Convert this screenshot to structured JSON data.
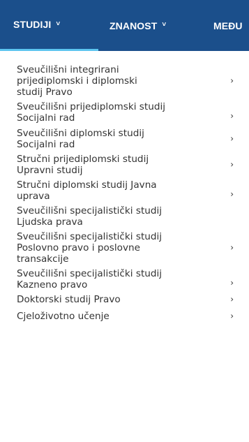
{
  "nav": {
    "items": [
      {
        "label": "STUDIJI",
        "active": true
      },
      {
        "label": "ZNANOST",
        "active": false
      },
      {
        "label": "MEĐU",
        "active": false
      }
    ],
    "chevron": "˅"
  },
  "menu": {
    "arrow": "›",
    "items": [
      {
        "label": "Sveučilišni integrirani\nprijediplomski i diplomski\nstudij Pravo",
        "has_arrow": true
      },
      {
        "label": "Sveučilišni prijediplomski studij\nSocijalni rad",
        "has_arrow": true
      },
      {
        "label": "Sveučilišni diplomski studij\nSocijalni rad",
        "has_arrow": true
      },
      {
        "label": "Stručni prijediplomski studij\nUpravni studij",
        "has_arrow": true
      },
      {
        "label": "Stručni diplomski studij Javna\nuprava",
        "has_arrow": true
      },
      {
        "label": "Sveučilišni specijalistički studij\nLjudska prava",
        "has_arrow": false
      },
      {
        "label": "Sveučilišni specijalistički studij\nPoslovno pravo i poslovne\ntransakcije",
        "has_arrow": true
      },
      {
        "label": "Sveučilišni specijalistički studij\nKazneno pravo",
        "has_arrow": true
      },
      {
        "label": "Doktorski studij Pravo",
        "has_arrow": true
      },
      {
        "label": "Cjeloživotno učenje",
        "has_arrow": true
      }
    ]
  },
  "colors": {
    "nav_bg": "#1b4f8b",
    "nav_text": "#ffffff",
    "active_underline": "#5dc5ef",
    "menu_text": "#333333"
  }
}
